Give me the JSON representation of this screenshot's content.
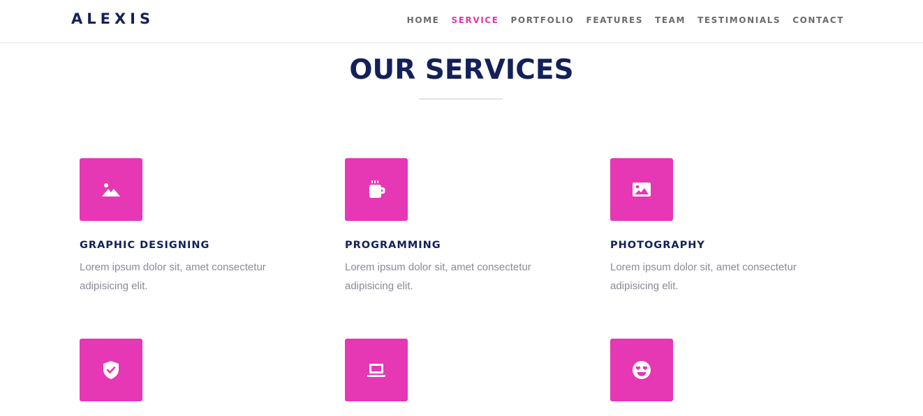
{
  "brand": "ALEXIS",
  "nav": {
    "items": [
      {
        "label": "HOME"
      },
      {
        "label": "SERVICE"
      },
      {
        "label": "PORTFOLIO"
      },
      {
        "label": "FEATURES"
      },
      {
        "label": "TEAM"
      },
      {
        "label": "TESTIMONIALS"
      },
      {
        "label": "CONTACT"
      }
    ],
    "active": "SERVICE"
  },
  "section": {
    "title": "OUR SERVICES"
  },
  "services": [
    {
      "icon": "image-mountain-icon",
      "title": "GRAPHIC DESIGNING",
      "description": "Lorem ipsum dolor sit, amet consectetur adipisicing elit."
    },
    {
      "icon": "coffee-mug-icon",
      "title": "PROGRAMMING",
      "description": "Lorem ipsum dolor sit, amet consectetur adipisicing elit."
    },
    {
      "icon": "photo-icon",
      "title": "PHOTOGRAPHY",
      "description": "Lorem ipsum dolor sit, amet consectetur adipisicing elit."
    },
    {
      "icon": "shield-check-icon",
      "title": "",
      "description": ""
    },
    {
      "icon": "laptop-icon",
      "title": "",
      "description": ""
    },
    {
      "icon": "smiley-heart-eyes-icon",
      "title": "",
      "description": ""
    }
  ],
  "colors": {
    "accent": "#e637b5",
    "navy": "#13205a",
    "muted_text": "#8a8a99",
    "nav_text": "#6b6b6b"
  }
}
